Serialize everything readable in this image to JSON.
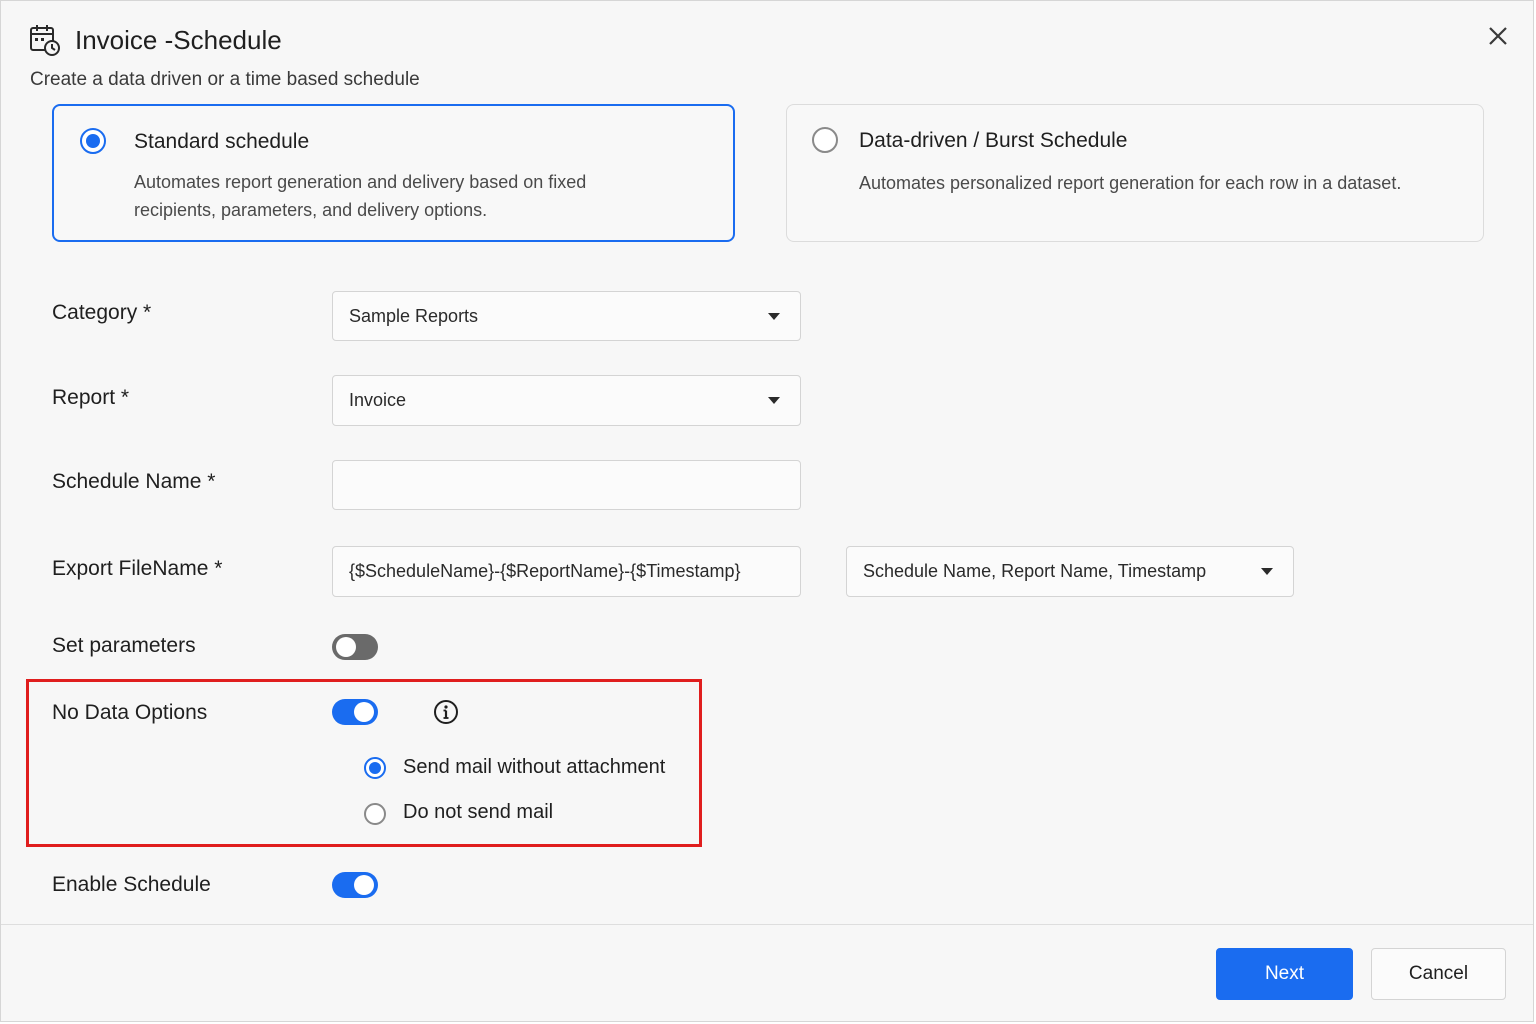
{
  "dialog": {
    "title": "Invoice -Schedule",
    "subtitle": "Create a data driven or a time based schedule",
    "title_icon": "calendar-clock-icon",
    "close_icon": "close-icon"
  },
  "schedule_types": [
    {
      "title": "Standard schedule",
      "description_line1": "Automates report generation and delivery based on fixed",
      "description_line2": "recipients, parameters, and delivery options.",
      "selected": true
    },
    {
      "title": "Data-driven / Burst Schedule",
      "description_line1": "Automates personalized report generation for each row in a dataset.",
      "selected": false
    }
  ],
  "form": {
    "category": {
      "label": "Category *",
      "value": "Sample Reports"
    },
    "report": {
      "label": "Report *",
      "value": "Invoice"
    },
    "schedule_name": {
      "label": "Schedule Name *",
      "value": ""
    },
    "export_filename": {
      "label": "Export FileName *",
      "value": "{$ScheduleName}-{$ReportName}-{$Timestamp}",
      "format_value": "Schedule Name, Report Name, Timestamp"
    },
    "set_parameters": {
      "label": "Set parameters",
      "enabled": false
    },
    "no_data_options": {
      "label": "No Data Options",
      "enabled": true,
      "info_icon": "info-icon",
      "options": [
        {
          "label": "Send mail without attachment",
          "selected": true
        },
        {
          "label": "Do not send mail",
          "selected": false
        }
      ]
    },
    "enable_schedule": {
      "label": "Enable Schedule",
      "enabled": true
    }
  },
  "footer": {
    "next_label": "Next",
    "cancel_label": "Cancel"
  },
  "colors": {
    "accent": "#1a6cf0",
    "highlight_border": "#e01e1e",
    "toggle_off": "#6a6a6a"
  }
}
